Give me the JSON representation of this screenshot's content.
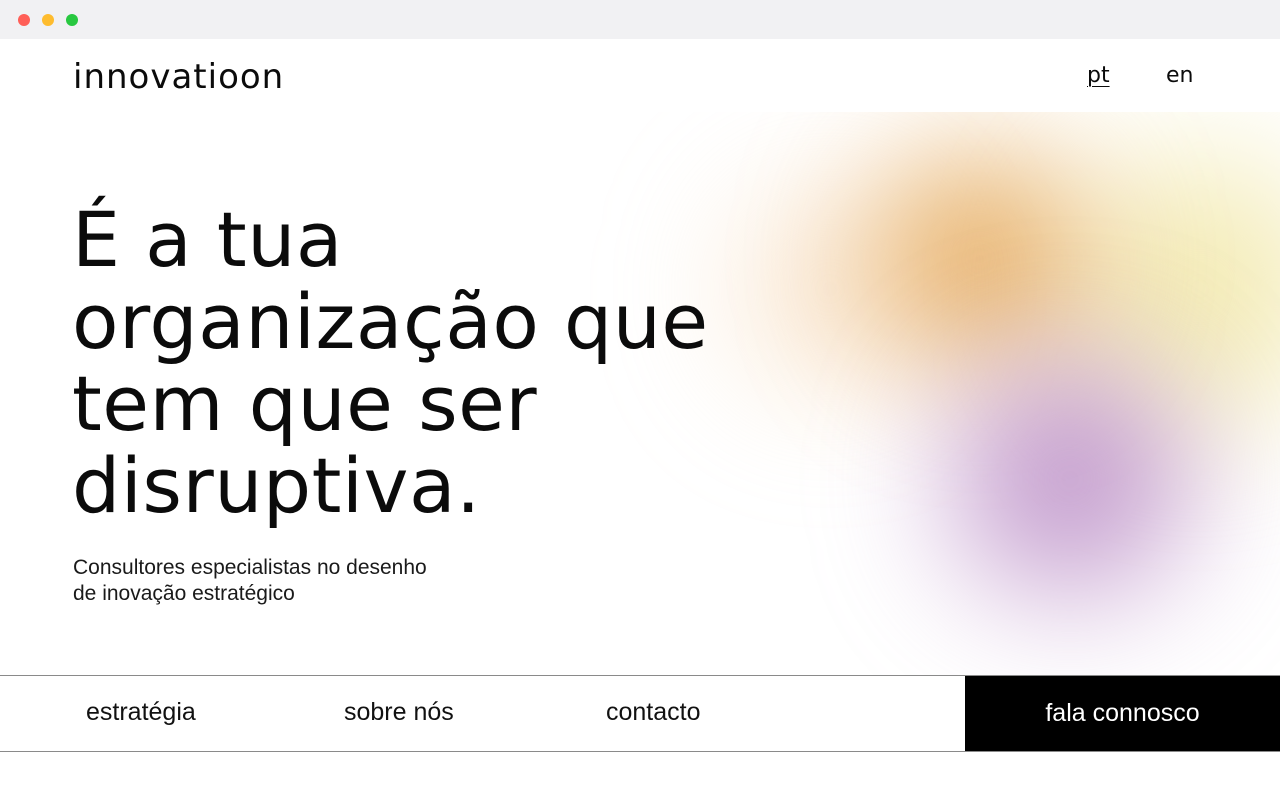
{
  "window": {
    "controls": [
      "close",
      "minimize",
      "zoom"
    ]
  },
  "header": {
    "logo": "innovatioon",
    "languages": [
      {
        "label": "pt",
        "active": true
      },
      {
        "label": "en",
        "active": false
      }
    ]
  },
  "hero": {
    "headline_lines": [
      "É a tua",
      "organização que",
      "tem que ser",
      "disruptiva."
    ],
    "subtitle_lines": [
      "Consultores especialistas no desenho",
      "de inovação estratégico"
    ]
  },
  "nav": {
    "items": [
      {
        "label": "estratégia"
      },
      {
        "label": "sobre nós"
      },
      {
        "label": "contacto"
      }
    ],
    "cta_label": "fala connosco"
  },
  "colors": {
    "background": "#ffffff",
    "text": "#0b0b0b",
    "cta_background": "#000000",
    "gradient_orange": "#e09a3e",
    "gradient_yellow": "#f1e7a5",
    "gradient_purple": "#b27fbf"
  }
}
